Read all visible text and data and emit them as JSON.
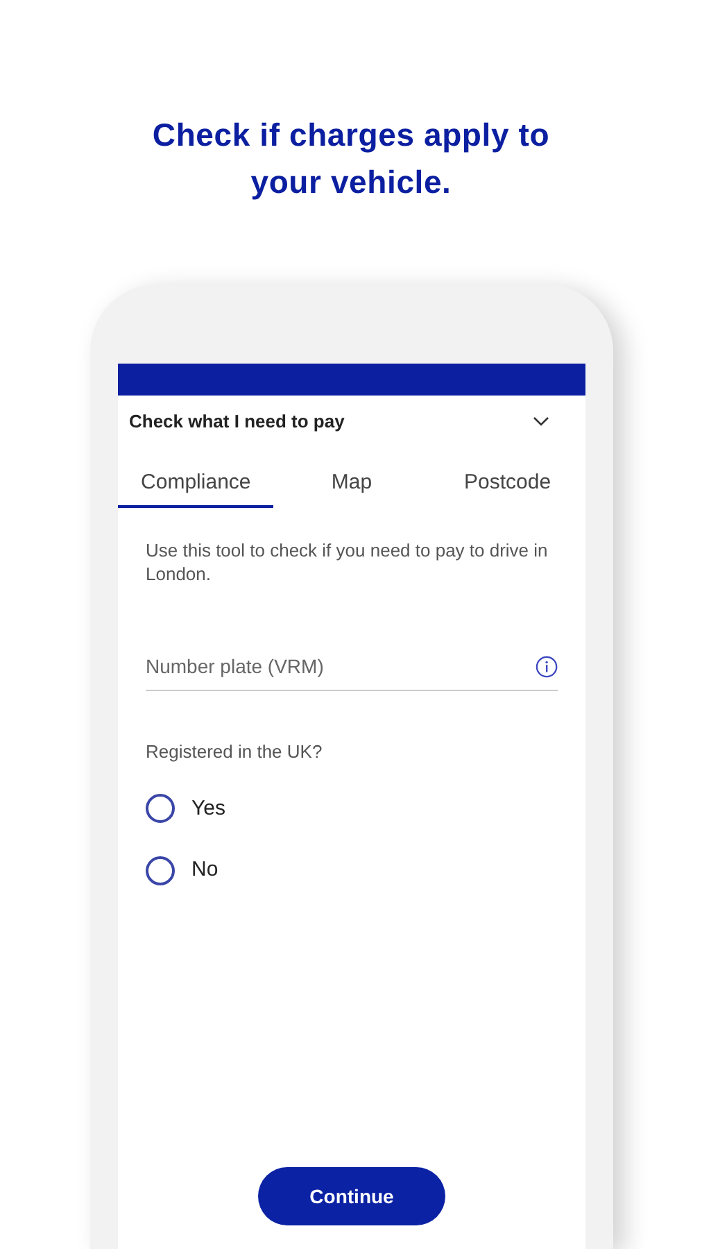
{
  "headline": "Check if charges apply to your vehicle.",
  "panel": {
    "title": "Check what I need to pay",
    "expanded": true
  },
  "tabs": [
    {
      "label": "Compliance",
      "selected": true
    },
    {
      "label": "Map",
      "selected": false
    },
    {
      "label": "Postcode",
      "selected": false
    }
  ],
  "description": "Use this tool to check if you need to pay to drive in London.",
  "number_plate": {
    "placeholder": "Number plate (VRM)"
  },
  "question": "Registered in the UK?",
  "options": [
    {
      "label": "Yes",
      "selected": false
    },
    {
      "label": "No",
      "selected": false
    }
  ],
  "button": "Continue"
}
